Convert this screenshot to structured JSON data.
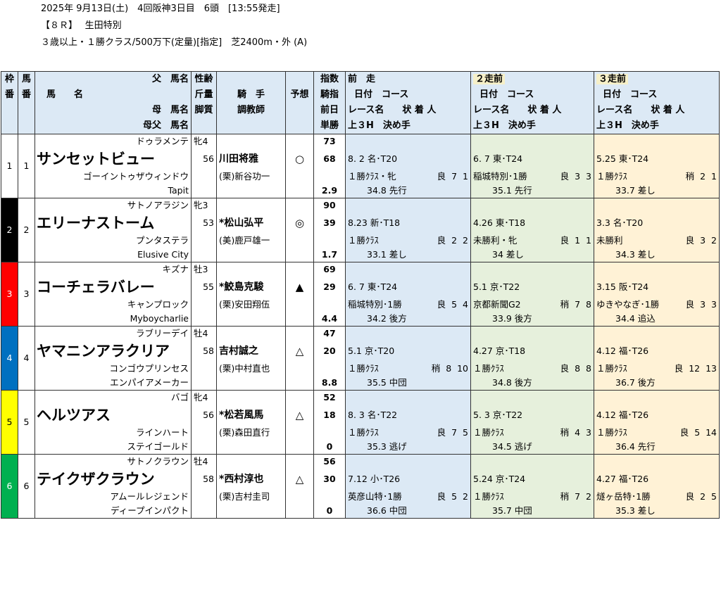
{
  "race": {
    "line1": "2025年 9月13日(土)　4回阪神3日目　6頭　[13:55発走]",
    "line2": "【８Ｒ】　 生田特別",
    "line3": "３歳以上・１勝クラス/500万下(定量)[指定]　芝2400m・外 (A)"
  },
  "header": {
    "waku": "枠番",
    "umaban": "馬番",
    "chichi": "父　馬名",
    "bamei": "馬　　名",
    "haha": "母　馬名",
    "hahachichi": "母父　馬名",
    "seirei": "性齢",
    "kinryo": "斤量",
    "kyakushitsu": "脚質",
    "kishu": "騎　手",
    "chokyoshi": "調教師",
    "yoso": "予想",
    "shisu": "指数",
    "kishi": "騎指",
    "zenjitsu": "前日",
    "tansho": "単勝",
    "zenso": "前　走",
    "niso": "２走前",
    "sanso": "３走前",
    "hiduke_course": "日付　コース",
    "race_jyo": "レース名　　状 着 人",
    "agari": "上３H　決め手"
  },
  "colors": {
    "w1": "#ffffff",
    "w2": "#000000",
    "w3": "#ff0000",
    "w4": "#0070c0",
    "w5": "#ffff00",
    "w6": "#00b050"
  },
  "horses": [
    {
      "waku": "1",
      "ban": "1",
      "sire": "ドゥラメンテ",
      "name": "サンセットビュー",
      "dam": "ゴーイントゥザウィンドウ",
      "damsire": "Tapit",
      "sexage": "牝4",
      "weight": "56",
      "style": "",
      "jockey": "川田将雅",
      "trainer": "(栗)新谷功一",
      "mark": "○",
      "idx": "73",
      "kidx": "68",
      "zen": "",
      "odds": "2.9",
      "r1": {
        "date": "8. 2",
        "course": "名･T20",
        "race": "１勝ｸﾗｽ・牝",
        "cond": "良",
        "pos": "7",
        "pop": "1",
        "agari": "34.8 先行"
      },
      "r2": {
        "date": "6. 7",
        "course": "東･T24",
        "race": "稲城特別･1勝",
        "cond": "良",
        "pos": "3",
        "pop": "3",
        "agari": "35.1 先行"
      },
      "r3": {
        "date": "5.25",
        "course": "東･T24",
        "race": "１勝ｸﾗｽ",
        "cond": "稍",
        "pos": "2",
        "pop": "1",
        "agari": "33.7 差し"
      }
    },
    {
      "waku": "2",
      "ban": "2",
      "sire": "サトノアラジン",
      "name": "エリーナストーム",
      "dam": "プンタステラ",
      "damsire": "Elusive City",
      "sexage": "牝3",
      "weight": "53",
      "style": "",
      "jockey": "*松山弘平",
      "trainer": "(美)鹿戸雄一",
      "mark": "◎",
      "idx": "90",
      "kidx": "39",
      "zen": "",
      "odds": "1.7",
      "r1": {
        "date": "8.23",
        "course": "新･T18",
        "race": "１勝ｸﾗｽ",
        "cond": "良",
        "pos": "2",
        "pop": "2",
        "agari": "33.1 差し"
      },
      "r2": {
        "date": "4.26",
        "course": "東･T18",
        "race": "未勝利・牝",
        "cond": "良",
        "pos": "1",
        "pop": "1",
        "agari": "34 差し"
      },
      "r3": {
        "date": "3.3",
        "course": "名･T20",
        "race": "未勝利",
        "cond": "良",
        "pos": "3",
        "pop": "2",
        "agari": "34.3 差し"
      }
    },
    {
      "waku": "3",
      "ban": "3",
      "sire": "キズナ",
      "name": "コーチェラバレー",
      "dam": "キャンプロック",
      "damsire": "Myboycharlie",
      "sexage": "牡3",
      "weight": "55",
      "style": "",
      "jockey": "*鮫島克駿",
      "trainer": "(栗)安田翔伍",
      "mark": "▲",
      "idx": "69",
      "kidx": "29",
      "zen": "",
      "odds": "4.4",
      "r1": {
        "date": "6. 7",
        "course": "東･T24",
        "race": "稲城特別･1勝",
        "cond": "良",
        "pos": "5",
        "pop": "4",
        "agari": "34.2 後方"
      },
      "r2": {
        "date": "5.1",
        "course": "京･T22",
        "race": "京都新聞G2",
        "cond": "稍",
        "pos": "7",
        "pop": "8",
        "agari": "33.9 後方"
      },
      "r3": {
        "date": "3.15",
        "course": "阪･T24",
        "race": "ゆきやなぎ･1勝",
        "cond": "良",
        "pos": "3",
        "pop": "3",
        "agari": "34.4 追込"
      }
    },
    {
      "waku": "4",
      "ban": "4",
      "sire": "ラブリーデイ",
      "name": "ヤマニンアラクリア",
      "dam": "コンゴウプリンセス",
      "damsire": "エンパイアメーカー",
      "sexage": "牡4",
      "weight": "58",
      "style": "",
      "jockey": "吉村誠之",
      "trainer": "(栗)中村直也",
      "mark": "△",
      "idx": "47",
      "kidx": "20",
      "zen": "",
      "odds": "8.8",
      "r1": {
        "date": "5.1",
        "course": "京･T20",
        "race": "１勝ｸﾗｽ",
        "cond": "稍",
        "pos": "8",
        "pop": "10",
        "agari": "35.5 中団"
      },
      "r2": {
        "date": "4.27",
        "course": "京･T18",
        "race": "１勝ｸﾗｽ",
        "cond": "良",
        "pos": "8",
        "pop": "8",
        "agari": "34.8 後方"
      },
      "r3": {
        "date": "4.12",
        "course": "福･T26",
        "race": "１勝ｸﾗｽ",
        "cond": "良",
        "pos": "12",
        "pop": "13",
        "agari": "36.7 後方"
      }
    },
    {
      "waku": "5",
      "ban": "5",
      "sire": "バゴ",
      "name": "ヘルツアス",
      "dam": "ラインハート",
      "damsire": "ステイゴールド",
      "sexage": "牝4",
      "weight": "56",
      "style": "",
      "jockey": "*松若風馬",
      "trainer": "(栗)森田直行",
      "mark": "△",
      "idx": "52",
      "kidx": "18",
      "zen": "",
      "odds": "0",
      "r1": {
        "date": "8. 3",
        "course": "名･T22",
        "race": "１勝ｸﾗｽ",
        "cond": "良",
        "pos": "7",
        "pop": "5",
        "agari": "35.3 逃げ"
      },
      "r2": {
        "date": "5. 3",
        "course": "京･T22",
        "race": "１勝ｸﾗｽ",
        "cond": "稍",
        "pos": "4",
        "pop": "3",
        "agari": "34.5 逃げ"
      },
      "r3": {
        "date": "4.12",
        "course": "福･T26",
        "race": "１勝ｸﾗｽ",
        "cond": "良",
        "pos": "5",
        "pop": "14",
        "agari": "36.4 先行"
      }
    },
    {
      "waku": "6",
      "ban": "6",
      "sire": "サトノクラウン",
      "name": "テイクザクラウン",
      "dam": "アムールレジェンド",
      "damsire": "ディープインパクト",
      "sexage": "牡4",
      "weight": "58",
      "style": "",
      "jockey": "*西村淳也",
      "trainer": "(栗)吉村圭司",
      "mark": "△",
      "idx": "56",
      "kidx": "30",
      "zen": "",
      "odds": "0",
      "r1": {
        "date": "7.12",
        "course": "小･T26",
        "race": "英彦山特･1勝",
        "cond": "良",
        "pos": "5",
        "pop": "2",
        "agari": "36.6 中団"
      },
      "r2": {
        "date": "5.24",
        "course": "京･T24",
        "race": "１勝ｸﾗｽ",
        "cond": "稍",
        "pos": "7",
        "pop": "2",
        "agari": "35.7 中団"
      },
      "r3": {
        "date": "4.27",
        "course": "福･T26",
        "race": "燧ヶ岳特･1勝",
        "cond": "良",
        "pos": "2",
        "pop": "5",
        "agari": "35.3 差し"
      }
    }
  ]
}
